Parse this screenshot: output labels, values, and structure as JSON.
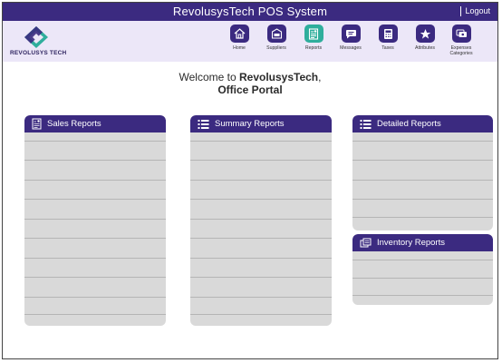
{
  "app": {
    "title": "RevolusysTech POS System",
    "logout": "Logout"
  },
  "logo": {
    "text": "REVOLUSYS TECH"
  },
  "nav": [
    {
      "label": "Home",
      "icon": "home-icon"
    },
    {
      "label": "Suppliers",
      "icon": "suppliers-icon"
    },
    {
      "label": "Reports",
      "icon": "reports-icon",
      "active": true
    },
    {
      "label": "Messages",
      "icon": "messages-icon"
    },
    {
      "label": "Taxes",
      "icon": "taxes-icon"
    },
    {
      "label": "Attributes",
      "icon": "star-icon"
    },
    {
      "label": "Expenses Categories",
      "icon": "expenses-icon"
    }
  ],
  "welcome": {
    "prefix": "Welcome to ",
    "brand": "RevolusysTech",
    "suffix": ",",
    "line2": "Office Portal"
  },
  "panels": {
    "sales": {
      "title": "Sales Reports"
    },
    "summary": {
      "title": "Summary Reports"
    },
    "detailed": {
      "title": "Detailed Reports"
    },
    "inventory": {
      "title": "Inventory Reports"
    }
  },
  "colors": {
    "primary": "#3b2a80",
    "accent": "#2fae9c",
    "navBg": "#ece7f8",
    "panelBg": "#d9d9d9"
  }
}
